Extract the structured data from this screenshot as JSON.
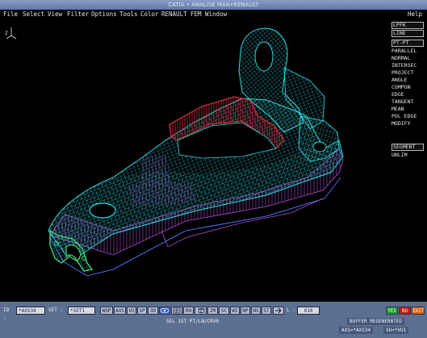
{
  "window": {
    "title": "CATIA • ANALISE MAN•RENAULT"
  },
  "menubar": {
    "items": [
      "File",
      "Select",
      "View",
      "Filter",
      "Options",
      "Tools",
      "Color",
      "RENAULT",
      "FEM",
      "Window"
    ],
    "help": "Help"
  },
  "axis": {
    "label_z": "Z"
  },
  "commands": [
    "LPFK",
    "LINE",
    "PT-PT",
    "PARALLEL",
    "NORMAL",
    "INTERSEC",
    "PROJECT",
    "ANGLE",
    "COMPON",
    "EDGE",
    "TANGENT",
    "MEAN",
    "POL EDGE",
    "MODIFY",
    "SEGMENT",
    "UNLIM"
  ],
  "toolbar": {
    "id_label": "ID :",
    "id_value": "*AXS34",
    "set_label": "SET :",
    "set_value": "*SET1",
    "buttons": [
      "WSP",
      "AXS",
      "VU",
      "SP",
      "3D",
      "RH",
      "ZM",
      "SC",
      "WI",
      "NP",
      "NS",
      "ST"
    ],
    "l_label": "L :",
    "l_value": "010",
    "yes": "YES",
    "no": "NO",
    "exit": "EXIT"
  },
  "status": {
    "prompt": "SEL 1ST PT/LN/CRV0",
    "message": "BUFFER REGENERATED",
    "axis_info": "AXS=*AXS34",
    "view_info": "VU=*VU1"
  },
  "colors": {
    "wire": "#2fd9e0",
    "magenta": "#b04cd8",
    "red": "#d42e3c",
    "green": "#46e07a",
    "panel": "#5b6f90"
  }
}
